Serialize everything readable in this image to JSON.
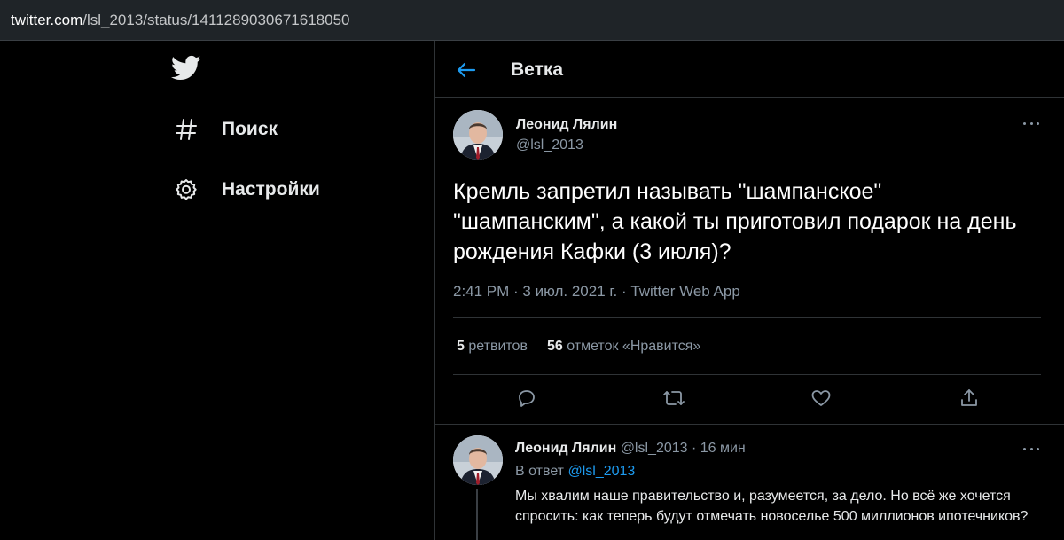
{
  "browser": {
    "url_host": "twitter.com",
    "url_path": "/lsl_2013/status/1411289030671618050"
  },
  "sidebar": {
    "logo_icon": "twitter-bird-icon",
    "items": [
      {
        "label": "Поиск",
        "icon": "hashtag-icon"
      },
      {
        "label": "Настройки",
        "icon": "gear-icon"
      }
    ]
  },
  "header": {
    "back_icon": "back-arrow-icon",
    "title": "Ветка"
  },
  "tweet": {
    "author_name": "Леонид Лялин",
    "author_handle": "@lsl_2013",
    "text": "Кремль запретил называть \"шампанское\" \"шампанским\", а какой ты приготовил подарок на день рождения Кафки (3 июля)?",
    "meta": "2:41 PM · 3 июл. 2021 г. · Twitter Web App",
    "retweets_count": "5",
    "retweets_label": "ретвитов",
    "likes_count": "56",
    "likes_label": "отметок «Нравится»"
  },
  "reply": {
    "author_name": "Леонид Лялин",
    "author_handle_time": "@lsl_2013 · 16 мин",
    "reply_to_prefix": "В ответ",
    "reply_to_handle": "@lsl_2013",
    "text": "Мы хвалим наше правительство и, разумеется, за дело. Но всё же хочется спросить: как теперь будут отмечать новоселье 500 миллионов ипотечников?"
  },
  "colors": {
    "background": "#000000",
    "accent": "#1d9bf0",
    "secondary_text": "#8b98a5",
    "divider": "#2f3336"
  }
}
